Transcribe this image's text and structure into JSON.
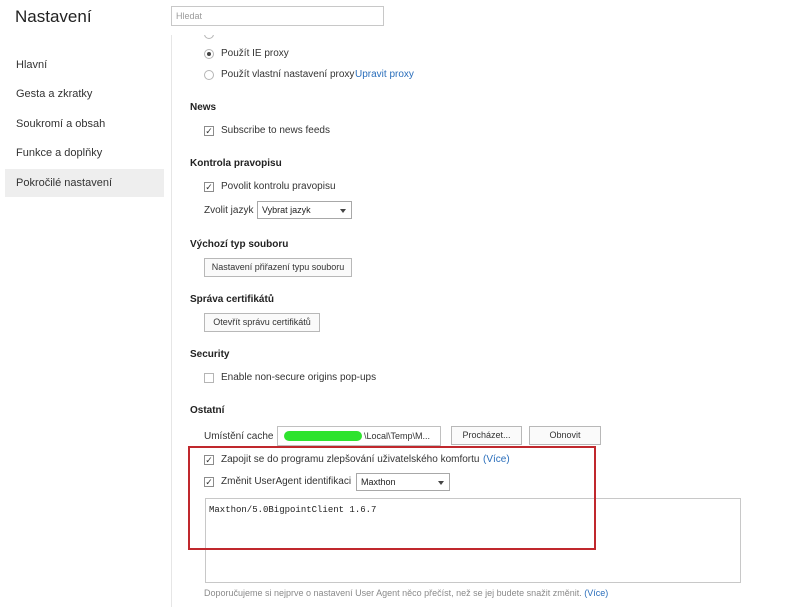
{
  "header": {
    "title": "Nastavení",
    "search_placeholder": "Hledat"
  },
  "sidebar": {
    "items": [
      {
        "label": "Hlavní"
      },
      {
        "label": "Gesta a zkratky"
      },
      {
        "label": "Soukromí a obsah"
      },
      {
        "label": "Funkce a doplňky"
      },
      {
        "label": "Pokročilé nastavení",
        "active": true
      }
    ]
  },
  "proxy": {
    "option_ie": "Použít IE proxy",
    "option_custom": "Použít vlastní nastavení proxy",
    "edit_link": "Upravit proxy",
    "selected": "ie"
  },
  "news": {
    "heading": "News",
    "subscribe_label": "Subscribe to news feeds",
    "subscribe_checked": true
  },
  "spellcheck": {
    "heading": "Kontrola pravopisu",
    "enable_label": "Povolit kontrolu pravopisu",
    "enable_checked": true,
    "language_label": "Zvolit jazyk",
    "language_value": "Vybrat jazyk"
  },
  "filetype": {
    "heading": "Výchozí typ souboru",
    "button": "Nastavení přiřazení typu souboru"
  },
  "certs": {
    "heading": "Správa certifikátů",
    "button": "Otevřít správu certifikátů"
  },
  "security": {
    "heading": "Security",
    "nonsecure_label": "Enable non-secure origins pop-ups",
    "nonsecure_checked": false
  },
  "other": {
    "heading": "Ostatní",
    "cache_label": "Umístění cache",
    "cache_value": "\\Local\\Temp\\M...",
    "browse_button": "Procházet...",
    "refresh_button": "Obnovit",
    "improve_label": "Zapojit se do programu zlepšování uživatelského komfortu",
    "improve_link": "(Více)",
    "improve_checked": true,
    "ua_label": "Změnit UserAgent identifikaci",
    "ua_checked": true,
    "ua_select": "Maxthon",
    "ua_value": "Maxthon/5.0BigpointClient 1.6.7",
    "note": "Doporučujeme si nejprve o nastavení User Agent něco přečíst, než se jej budete snažit změnit.",
    "note_link": "(Více)"
  },
  "colors": {
    "link": "#2a6ebb",
    "highlight_border": "#c0282d",
    "sidebar_active": "#eeeeee"
  }
}
